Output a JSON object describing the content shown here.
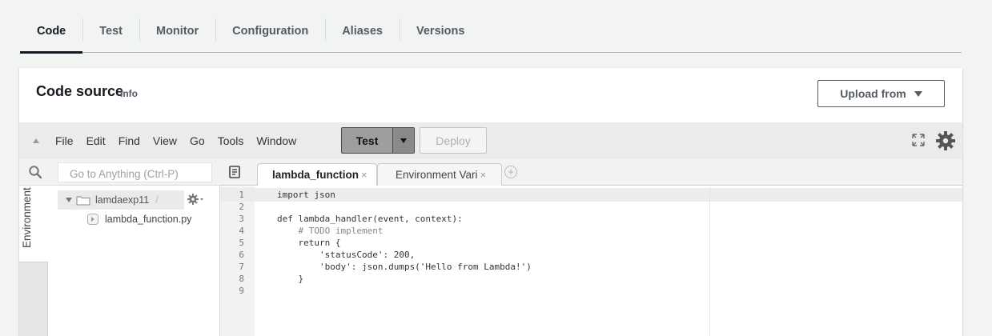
{
  "tabs": [
    "Code",
    "Test",
    "Monitor",
    "Configuration",
    "Aliases",
    "Versions"
  ],
  "code_source": {
    "title": "Code source",
    "info": "Info",
    "upload_label": "Upload from"
  },
  "ide": {
    "menu": [
      "File",
      "Edit",
      "Find",
      "View",
      "Go",
      "Tools",
      "Window"
    ],
    "test_label": "Test",
    "deploy_label": "Deploy",
    "search_placeholder": "Go to Anything (Ctrl-P)",
    "environment_label": "Environment",
    "tree": {
      "root": "lamdaexp11",
      "root_suffix": "/",
      "file": "lambda_function.py"
    },
    "editor_tabs": [
      {
        "label": "lambda_function",
        "close": "×"
      },
      {
        "label": "Environment Vari",
        "close": "×"
      }
    ],
    "add_tab": "+",
    "code_lines": [
      {
        "n": "1",
        "text": "import json"
      },
      {
        "n": "2",
        "text": ""
      },
      {
        "n": "3",
        "text": "def lambda_handler(event, context):"
      },
      {
        "n": "4",
        "text": "    # TODO implement"
      },
      {
        "n": "5",
        "text": "    return {"
      },
      {
        "n": "6",
        "text": "        'statusCode': 200,"
      },
      {
        "n": "7",
        "text": "        'body': json.dumps('Hello from Lambda!')"
      },
      {
        "n": "8",
        "text": "    }"
      },
      {
        "n": "9",
        "text": ""
      }
    ]
  }
}
